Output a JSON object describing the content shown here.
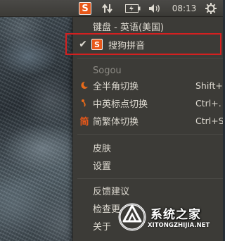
{
  "panel": {
    "ime_tray_letter": "S",
    "clock": "08:13",
    "icons": [
      "sogou-tray-icon",
      "network-icon",
      "battery-icon",
      "volume-icon",
      "gear-icon"
    ]
  },
  "menu": {
    "keyboard_item": "键盘 - 英语(美国)",
    "selected_ime": {
      "check": "✔",
      "icon_letter": "S",
      "label": "搜狗拼音"
    },
    "section_title": "Sogou",
    "toggles": [
      {
        "icon": "moon-icon",
        "label": "全半角切换",
        "accel": "Shift+"
      },
      {
        "icon": "punctuation-icon",
        "label": "中英标点切换",
        "accel": "Ctrl+."
      },
      {
        "icon_text": "简",
        "icon": "simplified-icon",
        "label": "简繁体切换",
        "accel": "Ctrl+S"
      }
    ],
    "skin": "皮肤",
    "settings": "设置",
    "feedback": "反馈建议",
    "check_update": "检查更",
    "about": "关于"
  },
  "watermark": {
    "title": "系统之家",
    "subtitle": "XITONGZHIJIA.NET"
  },
  "colors": {
    "panel_bg": "#3c3b37",
    "menu_bg": "#3c3b37",
    "sogou_orange": "#e8581a",
    "highlight_red": "#d42020",
    "text": "#dfdbd2",
    "section_text": "#8c8a84"
  }
}
